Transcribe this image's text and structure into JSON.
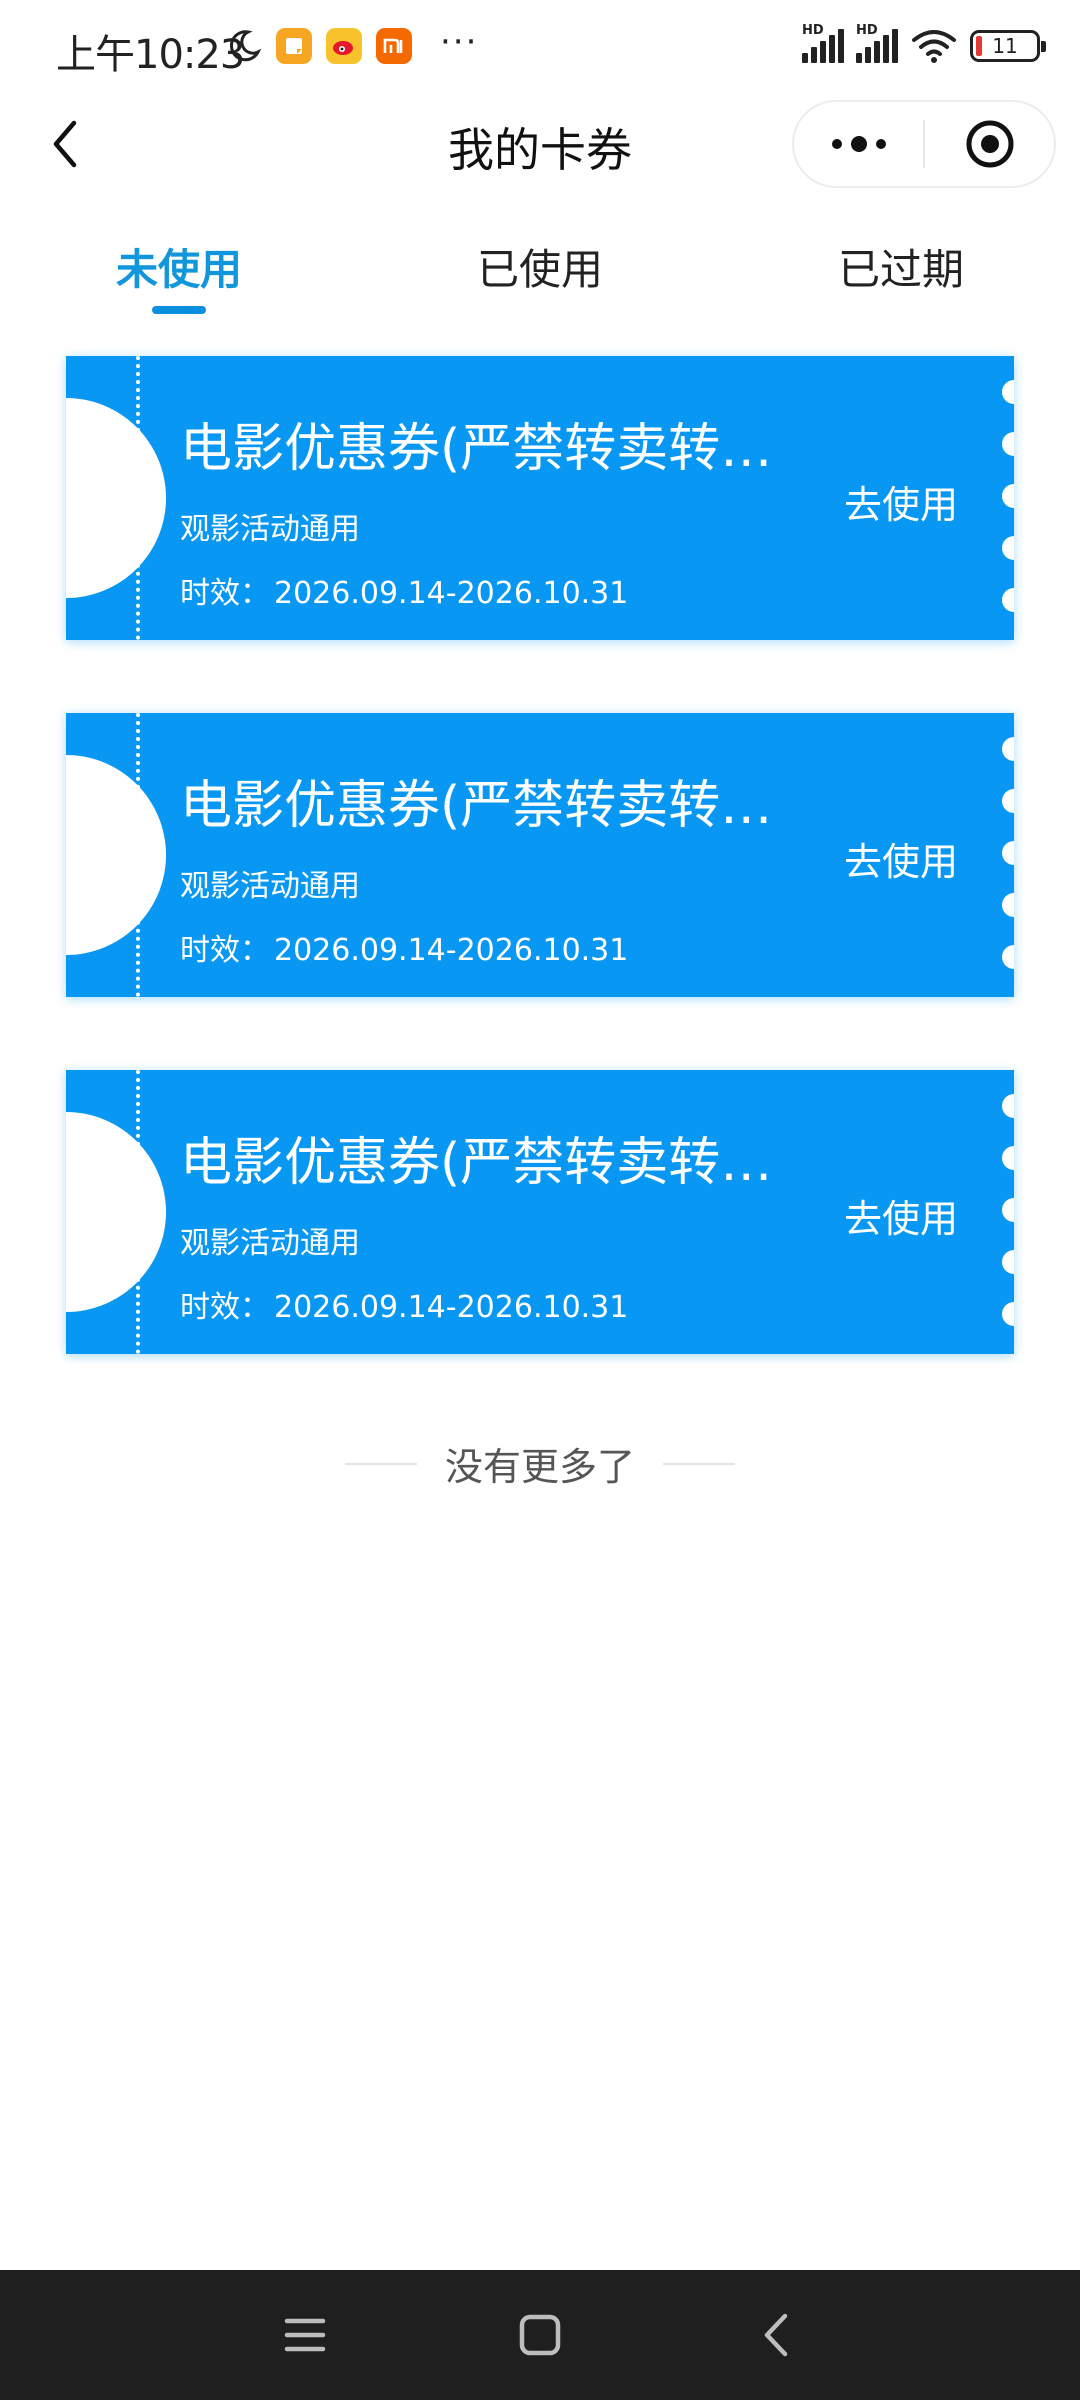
{
  "status_bar": {
    "time": "上午10:23",
    "battery_level": "11",
    "signal_label_1": "HD",
    "signal_label_2": "HD",
    "more_dots": "···"
  },
  "header": {
    "title": "我的卡券"
  },
  "tabs": [
    {
      "label": "未使用",
      "active": true
    },
    {
      "label": "已使用",
      "active": false
    },
    {
      "label": "已过期",
      "active": false
    }
  ],
  "coupons": [
    {
      "title": "电影优惠券(严禁转卖转…",
      "subtitle": "观影活动通用",
      "validity_label": "时效：",
      "validity_value": "2026.09.14-2026.10.31",
      "action": "去使用"
    },
    {
      "title": "电影优惠券(严禁转卖转…",
      "subtitle": "观影活动通用",
      "validity_label": "时效：",
      "validity_value": "2026.09.14-2026.10.31",
      "action": "去使用"
    },
    {
      "title": "电影优惠券(严禁转卖转…",
      "subtitle": "观影活动通用",
      "validity_label": "时效：",
      "validity_value": "2026.09.14-2026.10.31",
      "action": "去使用"
    }
  ],
  "list_end_text": "没有更多了",
  "colors": {
    "accent": "#0898f3",
    "tab_active": "#1296db",
    "nav_bar": "#1f1f1f"
  },
  "icons": {
    "back": "chevron-left-icon",
    "capsule_more": "more-dots-icon",
    "capsule_close": "target-circle-icon",
    "nav_menu": "menu-icon",
    "nav_home": "home-square-icon",
    "nav_back": "back-icon"
  }
}
